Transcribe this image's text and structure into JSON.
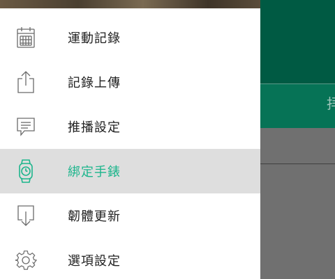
{
  "background": {
    "tab_text_fragment": "拝"
  },
  "drawer": {
    "menu": [
      {
        "label": "運動記錄",
        "icon": "calendar-icon",
        "active": false
      },
      {
        "label": "記錄上傳",
        "icon": "share-upload-icon",
        "active": false
      },
      {
        "label": "推播設定",
        "icon": "message-icon",
        "active": false
      },
      {
        "label": "綁定手錶",
        "icon": "watch-icon",
        "active": true
      },
      {
        "label": "韌體更新",
        "icon": "download-icon",
        "active": false
      },
      {
        "label": "選項設定",
        "icon": "gear-icon",
        "active": false
      }
    ]
  },
  "colors": {
    "accent": "#1cb58c",
    "header_green": "#005a43",
    "active_row_bg": "#dedede"
  }
}
